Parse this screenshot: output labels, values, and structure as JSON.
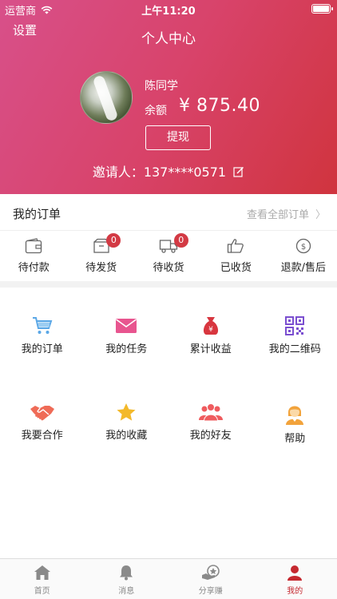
{
  "status_bar": {
    "carrier": "运营商",
    "time": "上午11:20"
  },
  "header": {
    "settings_label": "设置",
    "title": "个人中心",
    "username": "陈同学",
    "balance_label": "余额",
    "balance_value": "¥ 875.40",
    "withdraw_label": "提现",
    "inviter_text": "邀请人：137****0571"
  },
  "orders": {
    "title": "我的订单",
    "view_all": "查看全部订单",
    "items": [
      {
        "label": "待付款",
        "icon": "wallet-icon"
      },
      {
        "label": "待发货",
        "icon": "package-icon",
        "badge": "0"
      },
      {
        "label": "待收货",
        "icon": "truck-icon",
        "badge": "0"
      },
      {
        "label": "已收货",
        "icon": "thumbs-up-icon"
      },
      {
        "label": "退款/售后",
        "icon": "refund-icon"
      }
    ]
  },
  "features": [
    {
      "label": "我的订单",
      "icon": "cart-icon",
      "color": "#5aa7e6"
    },
    {
      "label": "我的任务",
      "icon": "envelope-icon",
      "color": "#e8558f"
    },
    {
      "label": "累计收益",
      "icon": "money-bag-icon",
      "color": "#d8363f"
    },
    {
      "label": "我的二维码",
      "icon": "qr-code-icon",
      "color": "#7b4fd0"
    },
    {
      "label": "我要合作",
      "icon": "handshake-icon",
      "color": "#ef6b57"
    },
    {
      "label": "我的收藏",
      "icon": "star-icon",
      "color": "#f3b92a"
    },
    {
      "label": "我的好友",
      "icon": "friends-icon",
      "color": "#ef5b5e"
    },
    {
      "label": "帮助",
      "icon": "help-person-icon",
      "color": "#f2a33b"
    }
  ],
  "tabbar": {
    "active_color": "#c5282f",
    "items": [
      {
        "label": "首页",
        "icon": "home-icon"
      },
      {
        "label": "消息",
        "icon": "bell-icon"
      },
      {
        "label": "分享赚",
        "icon": "share-earn-icon"
      },
      {
        "label": "我的",
        "icon": "user-icon",
        "active": true
      }
    ]
  }
}
